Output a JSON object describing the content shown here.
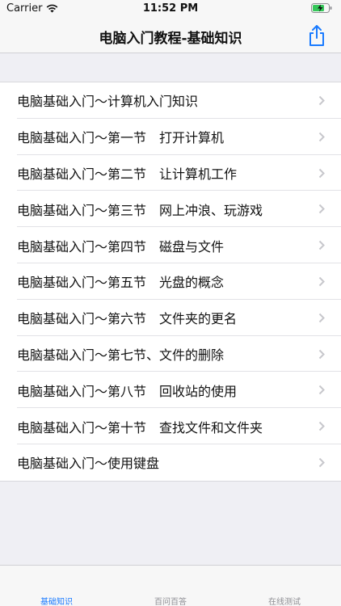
{
  "status": {
    "carrier": "Carrier",
    "time": "11:52 PM"
  },
  "nav": {
    "title": "电脑入门教程-基础知识",
    "accent": "#1a7bff"
  },
  "list": {
    "items": [
      {
        "label": "电脑基础入门～计算机入门知识"
      },
      {
        "label": "电脑基础入门～第一节　打开计算机"
      },
      {
        "label": "电脑基础入门～第二节　让计算机工作"
      },
      {
        "label": "电脑基础入门～第三节　网上冲浪、玩游戏"
      },
      {
        "label": "电脑基础入门～第四节　磁盘与文件"
      },
      {
        "label": "电脑基础入门～第五节　光盘的概念"
      },
      {
        "label": "电脑基础入门～第六节　文件夹的更名"
      },
      {
        "label": "电脑基础入门～第七节、文件的删除"
      },
      {
        "label": "电脑基础入门～第八节　回收站的使用"
      },
      {
        "label": "电脑基础入门～第十节　查找文件和文件夹"
      },
      {
        "label": "电脑基础入门～使用键盘"
      }
    ]
  },
  "tabs": [
    {
      "label": "基础知识",
      "selected": true
    },
    {
      "label": "百问百答",
      "selected": false
    },
    {
      "label": "在线测试",
      "selected": false
    }
  ]
}
